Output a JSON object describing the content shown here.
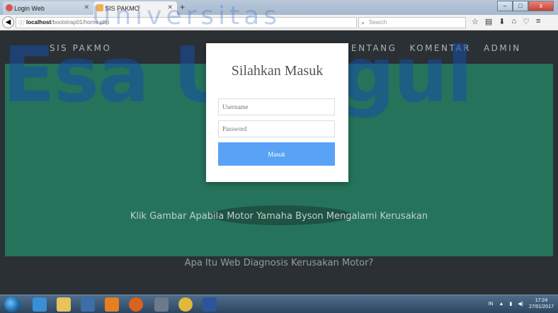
{
  "browser": {
    "tabs": [
      {
        "label": "Login Web",
        "active": false
      },
      {
        "label": "SIS PAKMO",
        "active": true
      }
    ],
    "new_tab": "+",
    "url_host": "localhost",
    "url_path": "/bootstrap01/home.php",
    "search_placeholder": "Search",
    "window_controls": [
      "–",
      "□",
      "x"
    ]
  },
  "site": {
    "brand": "SIS PAKMO",
    "menu": [
      "ENTANG",
      "KOMENTAR",
      "ADMIN"
    ],
    "hero_caption": "Klik Gambar Apabila Motor Yamaha Byson Mengalami Kerusakan",
    "bottom_title": "Apa Itu Web Diagnosis Kerusakan Motor?"
  },
  "watermark": {
    "small": "Universitas",
    "big": "Esa Unggul"
  },
  "login": {
    "title": "Silahkan Masuk",
    "username_placeholder": "Username",
    "password_placeholder": "Password",
    "submit_label": "Masuk"
  },
  "taskbar": {
    "lang": "IN",
    "time": "17:24",
    "date": "27/01/2017"
  },
  "colors": {
    "hero": "#2b8368",
    "page": "#30373c",
    "button": "#5aa2f6"
  }
}
